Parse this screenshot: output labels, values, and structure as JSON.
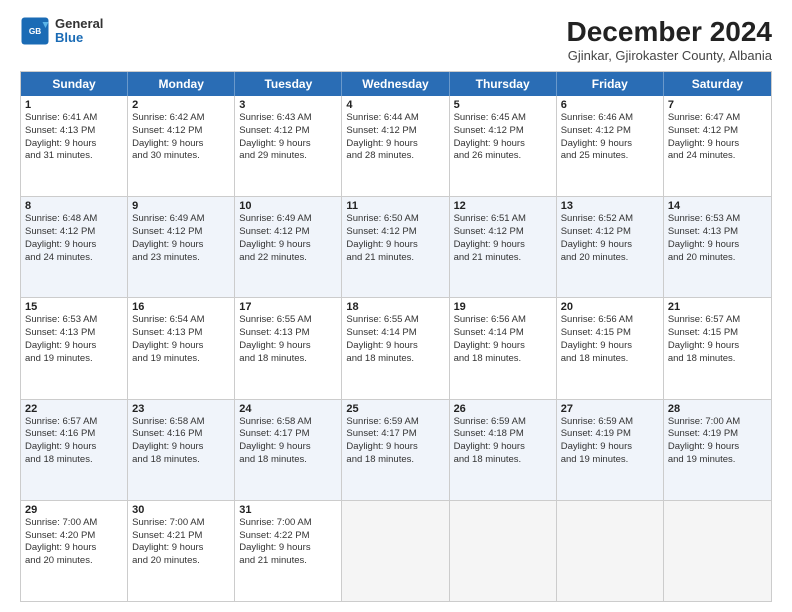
{
  "logo": {
    "general": "General",
    "blue": "Blue"
  },
  "header": {
    "title": "December 2024",
    "subtitle": "Gjinkar, Gjirokaster County, Albania"
  },
  "weekdays": [
    "Sunday",
    "Monday",
    "Tuesday",
    "Wednesday",
    "Thursday",
    "Friday",
    "Saturday"
  ],
  "weeks": [
    [
      {
        "day": "1",
        "lines": [
          "Sunrise: 6:41 AM",
          "Sunset: 4:13 PM",
          "Daylight: 9 hours",
          "and 31 minutes."
        ],
        "shaded": false
      },
      {
        "day": "2",
        "lines": [
          "Sunrise: 6:42 AM",
          "Sunset: 4:12 PM",
          "Daylight: 9 hours",
          "and 30 minutes."
        ],
        "shaded": false
      },
      {
        "day": "3",
        "lines": [
          "Sunrise: 6:43 AM",
          "Sunset: 4:12 PM",
          "Daylight: 9 hours",
          "and 29 minutes."
        ],
        "shaded": false
      },
      {
        "day": "4",
        "lines": [
          "Sunrise: 6:44 AM",
          "Sunset: 4:12 PM",
          "Daylight: 9 hours",
          "and 28 minutes."
        ],
        "shaded": false
      },
      {
        "day": "5",
        "lines": [
          "Sunrise: 6:45 AM",
          "Sunset: 4:12 PM",
          "Daylight: 9 hours",
          "and 26 minutes."
        ],
        "shaded": false
      },
      {
        "day": "6",
        "lines": [
          "Sunrise: 6:46 AM",
          "Sunset: 4:12 PM",
          "Daylight: 9 hours",
          "and 25 minutes."
        ],
        "shaded": false
      },
      {
        "day": "7",
        "lines": [
          "Sunrise: 6:47 AM",
          "Sunset: 4:12 PM",
          "Daylight: 9 hours",
          "and 24 minutes."
        ],
        "shaded": false
      }
    ],
    [
      {
        "day": "8",
        "lines": [
          "Sunrise: 6:48 AM",
          "Sunset: 4:12 PM",
          "Daylight: 9 hours",
          "and 24 minutes."
        ],
        "shaded": true
      },
      {
        "day": "9",
        "lines": [
          "Sunrise: 6:49 AM",
          "Sunset: 4:12 PM",
          "Daylight: 9 hours",
          "and 23 minutes."
        ],
        "shaded": true
      },
      {
        "day": "10",
        "lines": [
          "Sunrise: 6:49 AM",
          "Sunset: 4:12 PM",
          "Daylight: 9 hours",
          "and 22 minutes."
        ],
        "shaded": true
      },
      {
        "day": "11",
        "lines": [
          "Sunrise: 6:50 AM",
          "Sunset: 4:12 PM",
          "Daylight: 9 hours",
          "and 21 minutes."
        ],
        "shaded": true
      },
      {
        "day": "12",
        "lines": [
          "Sunrise: 6:51 AM",
          "Sunset: 4:12 PM",
          "Daylight: 9 hours",
          "and 21 minutes."
        ],
        "shaded": true
      },
      {
        "day": "13",
        "lines": [
          "Sunrise: 6:52 AM",
          "Sunset: 4:12 PM",
          "Daylight: 9 hours",
          "and 20 minutes."
        ],
        "shaded": true
      },
      {
        "day": "14",
        "lines": [
          "Sunrise: 6:53 AM",
          "Sunset: 4:13 PM",
          "Daylight: 9 hours",
          "and 20 minutes."
        ],
        "shaded": true
      }
    ],
    [
      {
        "day": "15",
        "lines": [
          "Sunrise: 6:53 AM",
          "Sunset: 4:13 PM",
          "Daylight: 9 hours",
          "and 19 minutes."
        ],
        "shaded": false
      },
      {
        "day": "16",
        "lines": [
          "Sunrise: 6:54 AM",
          "Sunset: 4:13 PM",
          "Daylight: 9 hours",
          "and 19 minutes."
        ],
        "shaded": false
      },
      {
        "day": "17",
        "lines": [
          "Sunrise: 6:55 AM",
          "Sunset: 4:13 PM",
          "Daylight: 9 hours",
          "and 18 minutes."
        ],
        "shaded": false
      },
      {
        "day": "18",
        "lines": [
          "Sunrise: 6:55 AM",
          "Sunset: 4:14 PM",
          "Daylight: 9 hours",
          "and 18 minutes."
        ],
        "shaded": false
      },
      {
        "day": "19",
        "lines": [
          "Sunrise: 6:56 AM",
          "Sunset: 4:14 PM",
          "Daylight: 9 hours",
          "and 18 minutes."
        ],
        "shaded": false
      },
      {
        "day": "20",
        "lines": [
          "Sunrise: 6:56 AM",
          "Sunset: 4:15 PM",
          "Daylight: 9 hours",
          "and 18 minutes."
        ],
        "shaded": false
      },
      {
        "day": "21",
        "lines": [
          "Sunrise: 6:57 AM",
          "Sunset: 4:15 PM",
          "Daylight: 9 hours",
          "and 18 minutes."
        ],
        "shaded": false
      }
    ],
    [
      {
        "day": "22",
        "lines": [
          "Sunrise: 6:57 AM",
          "Sunset: 4:16 PM",
          "Daylight: 9 hours",
          "and 18 minutes."
        ],
        "shaded": true
      },
      {
        "day": "23",
        "lines": [
          "Sunrise: 6:58 AM",
          "Sunset: 4:16 PM",
          "Daylight: 9 hours",
          "and 18 minutes."
        ],
        "shaded": true
      },
      {
        "day": "24",
        "lines": [
          "Sunrise: 6:58 AM",
          "Sunset: 4:17 PM",
          "Daylight: 9 hours",
          "and 18 minutes."
        ],
        "shaded": true
      },
      {
        "day": "25",
        "lines": [
          "Sunrise: 6:59 AM",
          "Sunset: 4:17 PM",
          "Daylight: 9 hours",
          "and 18 minutes."
        ],
        "shaded": true
      },
      {
        "day": "26",
        "lines": [
          "Sunrise: 6:59 AM",
          "Sunset: 4:18 PM",
          "Daylight: 9 hours",
          "and 18 minutes."
        ],
        "shaded": true
      },
      {
        "day": "27",
        "lines": [
          "Sunrise: 6:59 AM",
          "Sunset: 4:19 PM",
          "Daylight: 9 hours",
          "and 19 minutes."
        ],
        "shaded": true
      },
      {
        "day": "28",
        "lines": [
          "Sunrise: 7:00 AM",
          "Sunset: 4:19 PM",
          "Daylight: 9 hours",
          "and 19 minutes."
        ],
        "shaded": true
      }
    ],
    [
      {
        "day": "29",
        "lines": [
          "Sunrise: 7:00 AM",
          "Sunset: 4:20 PM",
          "Daylight: 9 hours",
          "and 20 minutes."
        ],
        "shaded": false
      },
      {
        "day": "30",
        "lines": [
          "Sunrise: 7:00 AM",
          "Sunset: 4:21 PM",
          "Daylight: 9 hours",
          "and 20 minutes."
        ],
        "shaded": false
      },
      {
        "day": "31",
        "lines": [
          "Sunrise: 7:00 AM",
          "Sunset: 4:22 PM",
          "Daylight: 9 hours",
          "and 21 minutes."
        ],
        "shaded": false
      },
      {
        "day": "",
        "lines": [],
        "empty": true,
        "shaded": false
      },
      {
        "day": "",
        "lines": [],
        "empty": true,
        "shaded": false
      },
      {
        "day": "",
        "lines": [],
        "empty": true,
        "shaded": false
      },
      {
        "day": "",
        "lines": [],
        "empty": true,
        "shaded": false
      }
    ]
  ]
}
